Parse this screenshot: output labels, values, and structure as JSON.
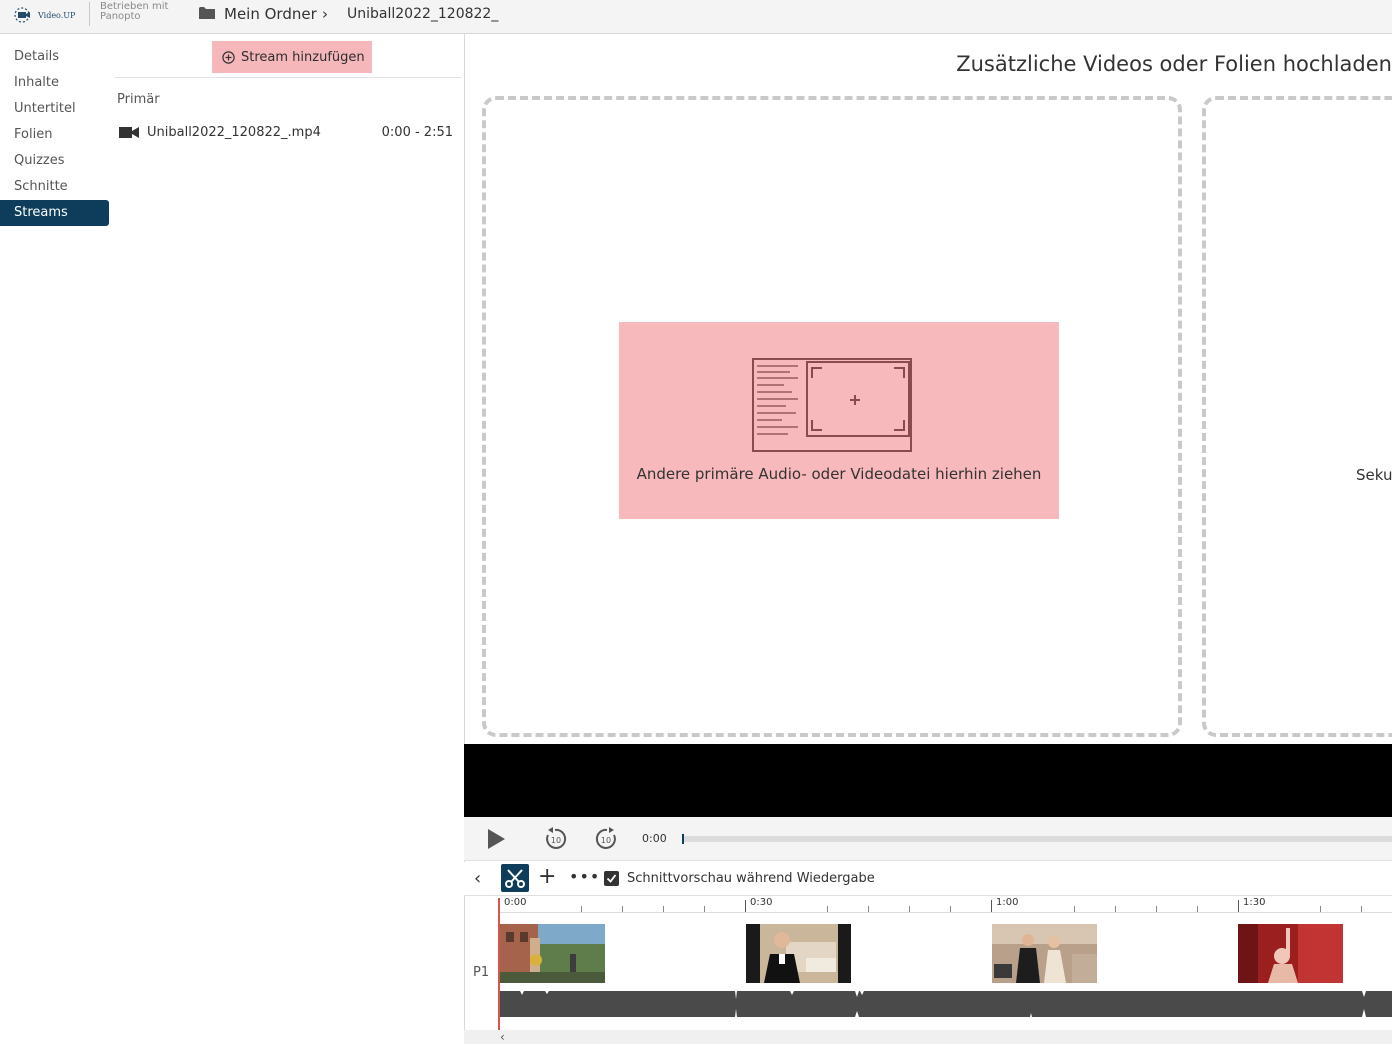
{
  "header": {
    "logo_text": "Video.UP",
    "powered_by_line1": "Betrieben mit",
    "powered_by_line2": "Panopto",
    "breadcrumb_folder": "Mein Ordner",
    "breadcrumb_file": "Uniball2022_120822_"
  },
  "sidebar": {
    "items": [
      {
        "label": "Details"
      },
      {
        "label": "Inhalte"
      },
      {
        "label": "Untertitel"
      },
      {
        "label": "Folien"
      },
      {
        "label": "Quizzes"
      },
      {
        "label": "Schnitte"
      },
      {
        "label": "Streams"
      }
    ],
    "active": "Streams"
  },
  "streams": {
    "add_button": "Stream hinzufügen",
    "primary_heading": "Primär",
    "primary_file": "Uniball2022_120822_.mp4",
    "primary_range": "0:00 - 2:51"
  },
  "upload": {
    "title": "Zusätzliche Videos oder Folien hochladen",
    "primary_drop_text": "Andere primäre Audio- oder Videodatei hierhin ziehen",
    "secondary_label": "Sekun"
  },
  "player": {
    "current_time": "0:00"
  },
  "editor_toolbar": {
    "cut_preview_label": "Schnittvorschau während Wiedergabe",
    "cut_preview_checked": true
  },
  "timeline": {
    "ticks": [
      "0:00",
      "0:30",
      "1:00",
      "1:30"
    ],
    "track_label": "P1"
  },
  "colors": {
    "accent": "#0e3d5c",
    "drop_highlight": "#f8b9bc",
    "playhead": "#d9534f"
  }
}
